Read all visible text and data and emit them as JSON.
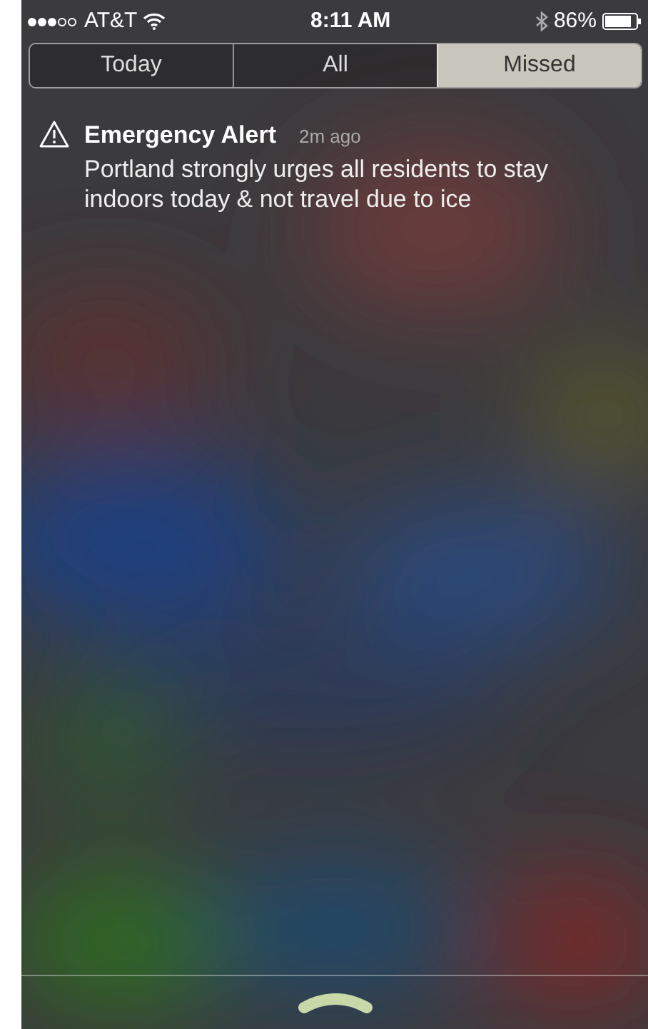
{
  "status_bar": {
    "carrier": "AT&T",
    "time": "8:11 AM",
    "battery": "86%"
  },
  "tabs": [
    {
      "label": "Today",
      "selected": false
    },
    {
      "label": "All",
      "selected": false
    },
    {
      "label": "Missed",
      "selected": true
    }
  ],
  "notifications": [
    {
      "title": "Emergency Alert",
      "time": "2m ago",
      "body": "Portland strongly urges all residents to stay indoors today & not travel due to ice"
    }
  ]
}
